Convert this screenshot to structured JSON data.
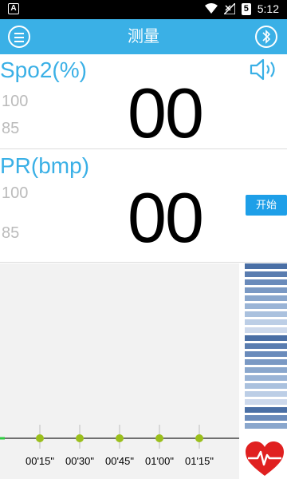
{
  "status_bar": {
    "left_icon": "A",
    "badge": "5",
    "time": "5:12",
    "icons": [
      "wifi-icon",
      "signal-icon",
      "battery-icon"
    ]
  },
  "header": {
    "title": "测量",
    "menu_icon": "menu-icon",
    "bluetooth_icon": "bluetooth-icon"
  },
  "spo2": {
    "label": "Spo2(%)",
    "upper_limit": "100",
    "lower_limit": "85",
    "value": "00"
  },
  "pr": {
    "label": "PR(bmp)",
    "upper_limit": "100",
    "lower_limit": "85",
    "value": "00"
  },
  "start_button": "开始",
  "chart": {
    "time_labels": [
      "00'15\"",
      "00'30\"",
      "00'45\"",
      "01'00\"",
      "01'15\""
    ]
  },
  "colors": {
    "accent": "#3ab0e6",
    "button": "#1e9fe8",
    "heart": "#e02020",
    "marker": "#9bbf1c"
  }
}
